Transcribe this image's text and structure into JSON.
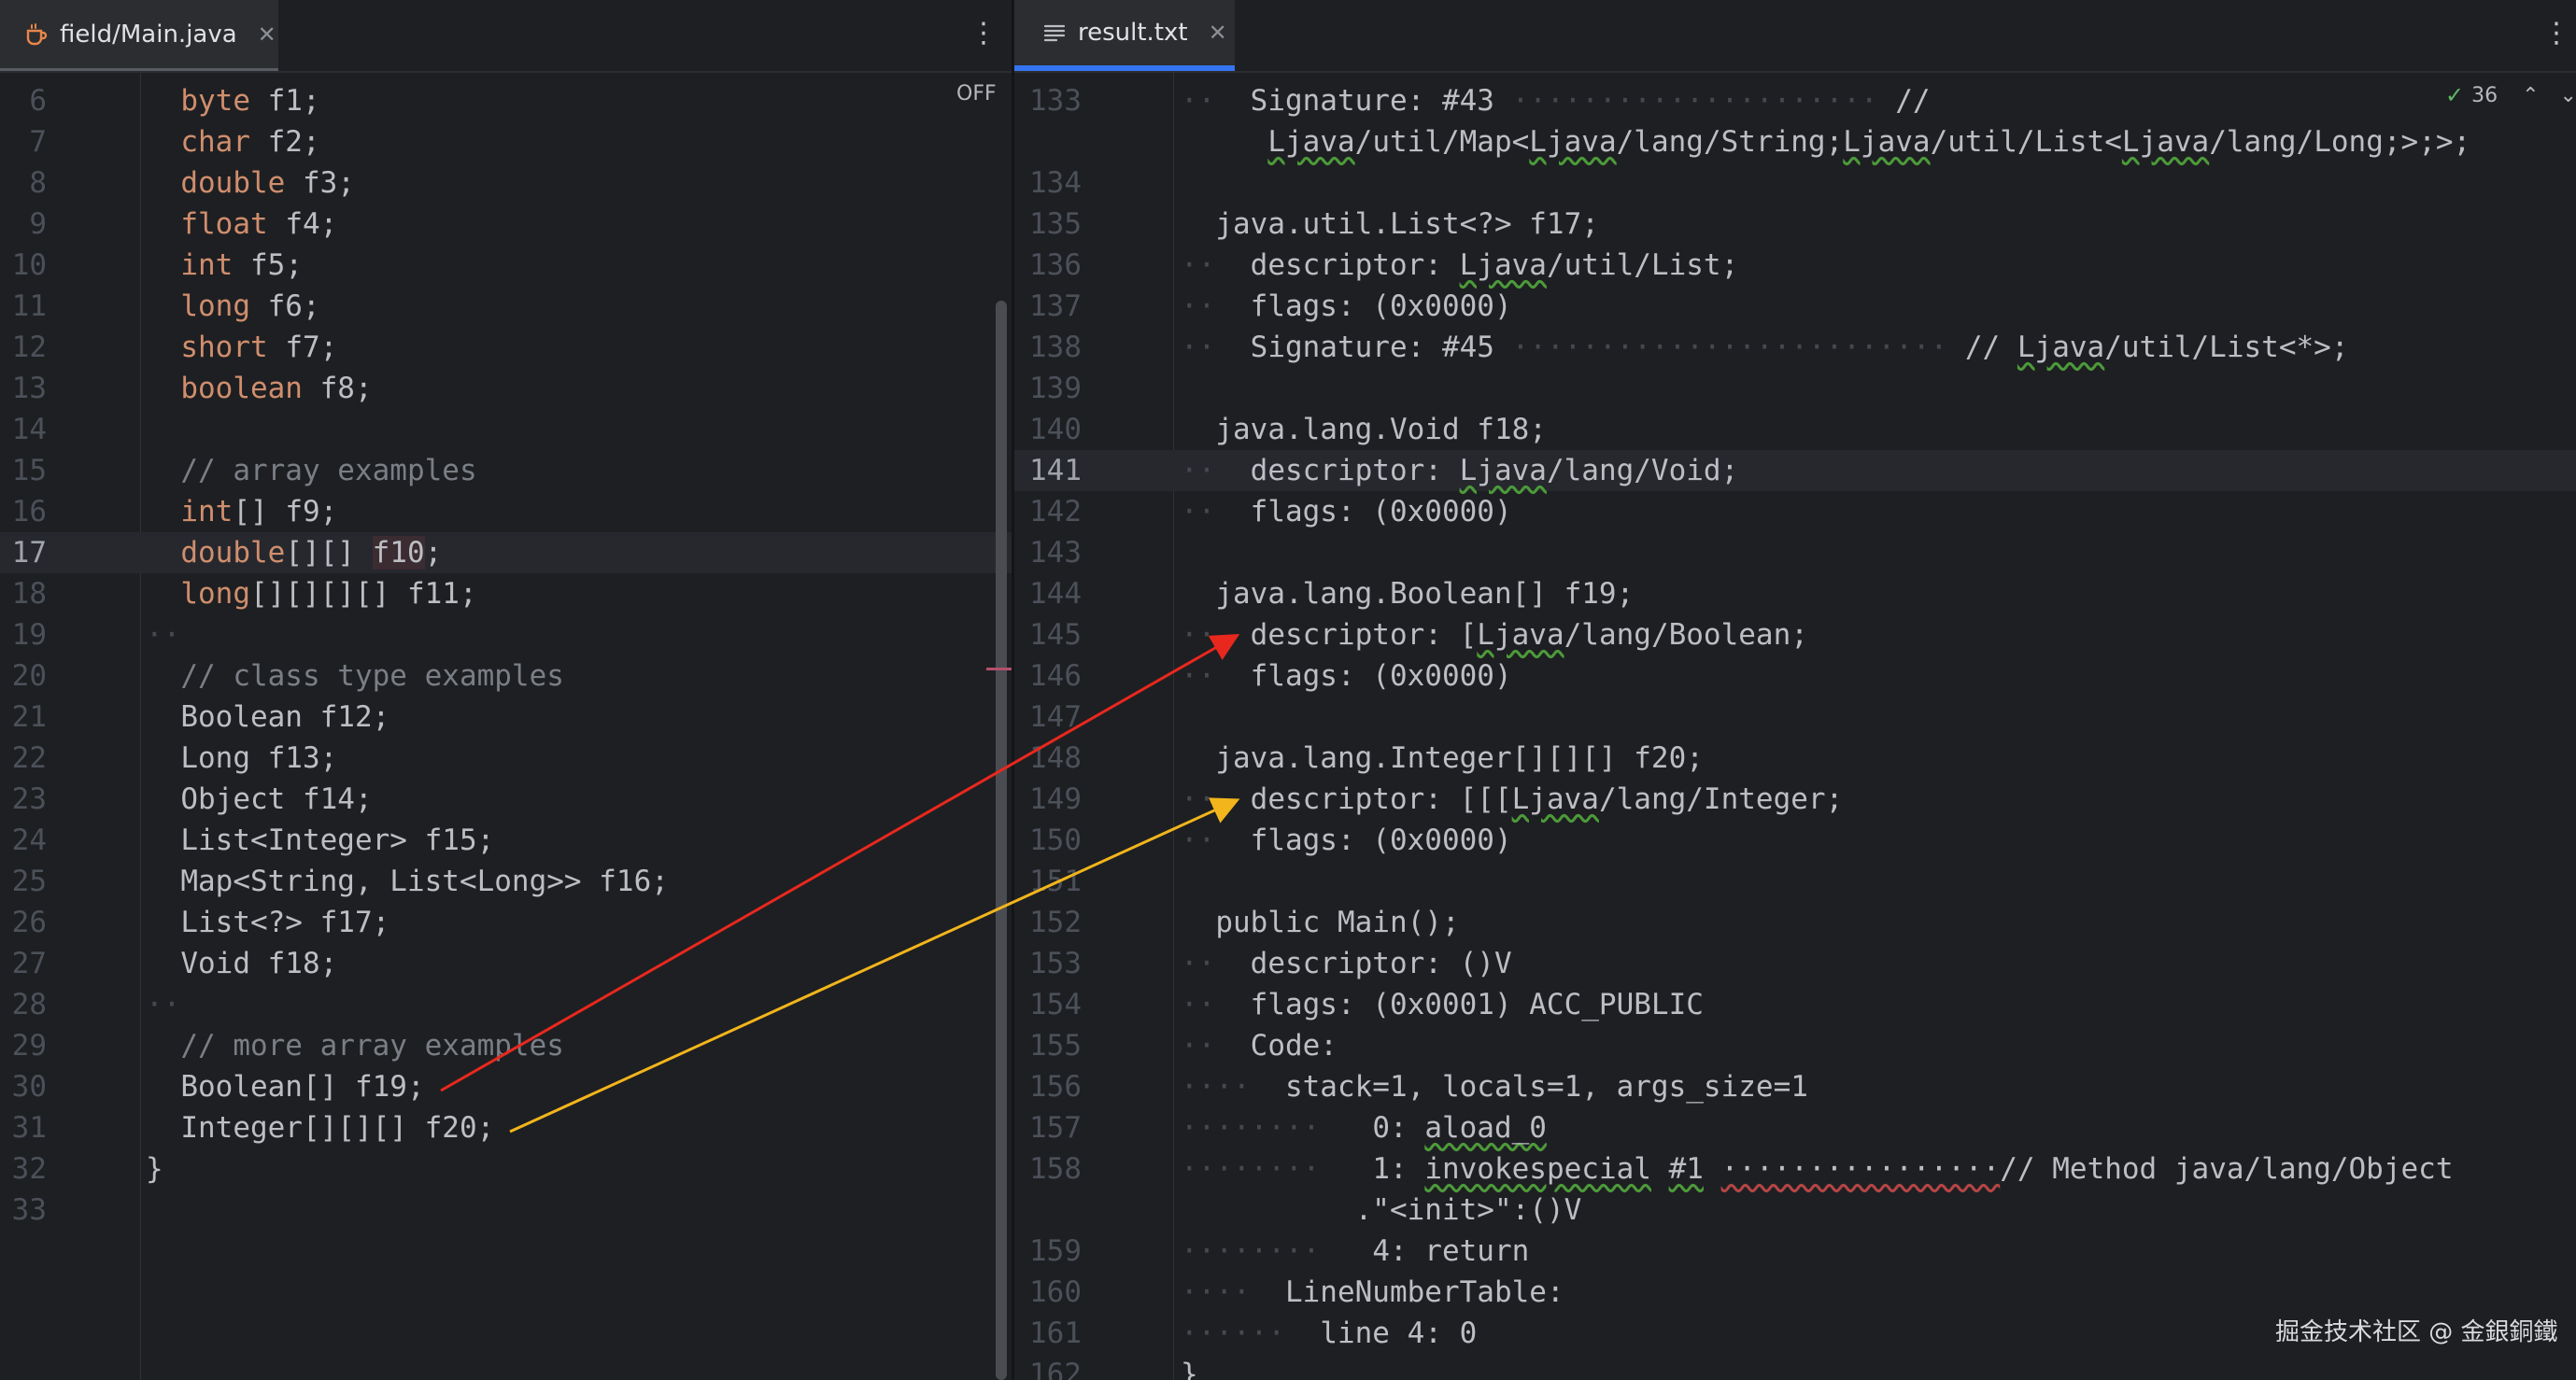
{
  "left_editor": {
    "tab_label": "field/Main.java",
    "off_label": "OFF",
    "lines": [
      {
        "n": "6",
        "tokens": [
          {
            "t": "  ",
            "c": "ws"
          },
          {
            "t": "byte",
            "c": "kw"
          },
          {
            "t": " f1;"
          }
        ]
      },
      {
        "n": "7",
        "tokens": [
          {
            "t": "  ",
            "c": "ws"
          },
          {
            "t": "char",
            "c": "kw"
          },
          {
            "t": " f2;"
          }
        ]
      },
      {
        "n": "8",
        "tokens": [
          {
            "t": "  ",
            "c": "ws"
          },
          {
            "t": "double",
            "c": "kw"
          },
          {
            "t": " f3;"
          }
        ]
      },
      {
        "n": "9",
        "tokens": [
          {
            "t": "  ",
            "c": "ws"
          },
          {
            "t": "float",
            "c": "kw"
          },
          {
            "t": " f4;"
          }
        ]
      },
      {
        "n": "10",
        "tokens": [
          {
            "t": "  ",
            "c": "ws"
          },
          {
            "t": "int",
            "c": "kw"
          },
          {
            "t": " f5;"
          }
        ]
      },
      {
        "n": "11",
        "tokens": [
          {
            "t": "  ",
            "c": "ws"
          },
          {
            "t": "long",
            "c": "kw"
          },
          {
            "t": " f6;"
          }
        ]
      },
      {
        "n": "12",
        "tokens": [
          {
            "t": "  ",
            "c": "ws"
          },
          {
            "t": "short",
            "c": "kw"
          },
          {
            "t": " f7;"
          }
        ]
      },
      {
        "n": "13",
        "tokens": [
          {
            "t": "  ",
            "c": "ws"
          },
          {
            "t": "boolean",
            "c": "kw"
          },
          {
            "t": " f8;"
          }
        ]
      },
      {
        "n": "14",
        "tokens": []
      },
      {
        "n": "15",
        "tokens": [
          {
            "t": "  ",
            "c": "ws"
          },
          {
            "t": "// array examples",
            "c": "cm"
          }
        ]
      },
      {
        "n": "16",
        "tokens": [
          {
            "t": "  ",
            "c": "ws"
          },
          {
            "t": "int",
            "c": "kw"
          },
          {
            "t": "[] f9;"
          }
        ]
      },
      {
        "n": "17",
        "current": true,
        "tokens": [
          {
            "t": "  ",
            "c": "ws"
          },
          {
            "t": "double",
            "c": "kw"
          },
          {
            "t": "[][] "
          },
          {
            "t": "f10",
            "c": "hl"
          },
          {
            "t": ";"
          }
        ]
      },
      {
        "n": "18",
        "tokens": [
          {
            "t": "  ",
            "c": "ws"
          },
          {
            "t": "long",
            "c": "kw"
          },
          {
            "t": "[][][][] f11;"
          }
        ]
      },
      {
        "n": "19",
        "tokens": [
          {
            "t": "··",
            "c": "ws"
          }
        ]
      },
      {
        "n": "20",
        "tokens": [
          {
            "t": "  ",
            "c": "ws"
          },
          {
            "t": "// class type examples",
            "c": "cm"
          }
        ]
      },
      {
        "n": "21",
        "tokens": [
          {
            "t": "  ",
            "c": "ws"
          },
          {
            "t": "Boolean f12;"
          }
        ]
      },
      {
        "n": "22",
        "tokens": [
          {
            "t": "  ",
            "c": "ws"
          },
          {
            "t": "Long f13;"
          }
        ]
      },
      {
        "n": "23",
        "tokens": [
          {
            "t": "  ",
            "c": "ws"
          },
          {
            "t": "Object f14;"
          }
        ]
      },
      {
        "n": "24",
        "tokens": [
          {
            "t": "  ",
            "c": "ws"
          },
          {
            "t": "List<Integer> f15;"
          }
        ]
      },
      {
        "n": "25",
        "tokens": [
          {
            "t": "  ",
            "c": "ws"
          },
          {
            "t": "Map<String, List<Long>> f16;"
          }
        ]
      },
      {
        "n": "26",
        "tokens": [
          {
            "t": "  ",
            "c": "ws"
          },
          {
            "t": "List<?> f17;"
          }
        ]
      },
      {
        "n": "27",
        "tokens": [
          {
            "t": "  ",
            "c": "ws"
          },
          {
            "t": "Void f18;"
          }
        ]
      },
      {
        "n": "28",
        "tokens": [
          {
            "t": "··",
            "c": "ws"
          }
        ]
      },
      {
        "n": "29",
        "tokens": [
          {
            "t": "  ",
            "c": "ws"
          },
          {
            "t": "// more array examples",
            "c": "cm"
          }
        ]
      },
      {
        "n": "30",
        "tokens": [
          {
            "t": "  ",
            "c": "ws"
          },
          {
            "t": "Boolean[] f19;"
          }
        ]
      },
      {
        "n": "31",
        "tokens": [
          {
            "t": "  ",
            "c": "ws"
          },
          {
            "t": "Integer[][][] f20;"
          }
        ]
      },
      {
        "n": "32",
        "tokens": [
          {
            "t": "}"
          }
        ]
      },
      {
        "n": "33",
        "tokens": []
      }
    ]
  },
  "right_editor": {
    "tab_label": "result.txt",
    "inspection_count": "36",
    "lines": [
      {
        "n": "133",
        "tokens": [
          {
            "t": "··  ",
            "c": "ws"
          },
          {
            "t": "Signature: #43 "
          },
          {
            "t": "·····················",
            "c": "ws"
          },
          {
            "t": " //"
          }
        ]
      },
      {
        "n": "",
        "tokens": [
          {
            "t": "     "
          },
          {
            "t": "Ljava",
            "c": "sq"
          },
          {
            "t": "/util/Map<"
          },
          {
            "t": "Ljava",
            "c": "sq"
          },
          {
            "t": "/lang/String;"
          },
          {
            "t": "Ljava",
            "c": "sq"
          },
          {
            "t": "/util/List<"
          },
          {
            "t": "Ljava",
            "c": "sq"
          },
          {
            "t": "/lang/Long;>;>;"
          }
        ]
      },
      {
        "n": "134",
        "tokens": []
      },
      {
        "n": "135",
        "tokens": [
          {
            "t": "  ",
            "c": "ws"
          },
          {
            "t": "java.util.List<?> f17;"
          }
        ]
      },
      {
        "n": "136",
        "tokens": [
          {
            "t": "··  ",
            "c": "ws"
          },
          {
            "t": "descriptor: "
          },
          {
            "t": "Ljava",
            "c": "sq"
          },
          {
            "t": "/util/List;"
          }
        ]
      },
      {
        "n": "137",
        "tokens": [
          {
            "t": "··  ",
            "c": "ws"
          },
          {
            "t": "flags: (0x0000)"
          }
        ]
      },
      {
        "n": "138",
        "tokens": [
          {
            "t": "··  ",
            "c": "ws"
          },
          {
            "t": "Signature: #45 "
          },
          {
            "t": "·························",
            "c": "ws"
          },
          {
            "t": " // "
          },
          {
            "t": "Ljava",
            "c": "sq"
          },
          {
            "t": "/util/List<*>;"
          }
        ]
      },
      {
        "n": "139",
        "tokens": []
      },
      {
        "n": "140",
        "tokens": [
          {
            "t": "  ",
            "c": "ws"
          },
          {
            "t": "java.lang.Void f18;"
          }
        ]
      },
      {
        "n": "141",
        "current": true,
        "tokens": [
          {
            "t": "··  ",
            "c": "ws"
          },
          {
            "t": "descriptor: "
          },
          {
            "t": "Ljava",
            "c": "sq"
          },
          {
            "t": "/lang/Void;"
          }
        ]
      },
      {
        "n": "142",
        "tokens": [
          {
            "t": "··  ",
            "c": "ws"
          },
          {
            "t": "flags: (0x0000)"
          }
        ]
      },
      {
        "n": "143",
        "tokens": []
      },
      {
        "n": "144",
        "tokens": [
          {
            "t": "  ",
            "c": "ws"
          },
          {
            "t": "java.lang.Boolean[] f19;"
          }
        ]
      },
      {
        "n": "145",
        "tokens": [
          {
            "t": "··  ",
            "c": "ws"
          },
          {
            "t": "descriptor: ["
          },
          {
            "t": "Ljava",
            "c": "sq"
          },
          {
            "t": "/lang/Boolean;"
          }
        ]
      },
      {
        "n": "146",
        "tokens": [
          {
            "t": "··  ",
            "c": "ws"
          },
          {
            "t": "flags: (0x0000)"
          }
        ]
      },
      {
        "n": "147",
        "tokens": []
      },
      {
        "n": "148",
        "tokens": [
          {
            "t": "  ",
            "c": "ws"
          },
          {
            "t": "java.lang.Integer[][][] f20;"
          }
        ]
      },
      {
        "n": "149",
        "tokens": [
          {
            "t": "··  ",
            "c": "ws"
          },
          {
            "t": "descriptor: [[["
          },
          {
            "t": "Ljava",
            "c": "sq"
          },
          {
            "t": "/lang/Integer;"
          }
        ]
      },
      {
        "n": "150",
        "tokens": [
          {
            "t": "··  ",
            "c": "ws"
          },
          {
            "t": "flags: (0x0000)"
          }
        ]
      },
      {
        "n": "151",
        "tokens": []
      },
      {
        "n": "152",
        "tokens": [
          {
            "t": "  ",
            "c": "ws"
          },
          {
            "t": "public Main();"
          }
        ]
      },
      {
        "n": "153",
        "tokens": [
          {
            "t": "··  ",
            "c": "ws"
          },
          {
            "t": "descriptor: ()V"
          }
        ]
      },
      {
        "n": "154",
        "tokens": [
          {
            "t": "··  ",
            "c": "ws"
          },
          {
            "t": "flags: (0x0001) ACC_PUBLIC"
          }
        ]
      },
      {
        "n": "155",
        "tokens": [
          {
            "t": "··  ",
            "c": "ws"
          },
          {
            "t": "Code:"
          }
        ]
      },
      {
        "n": "156",
        "tokens": [
          {
            "t": "····  ",
            "c": "ws"
          },
          {
            "t": "stack=1, locals=1, args_size=1"
          }
        ]
      },
      {
        "n": "157",
        "tokens": [
          {
            "t": "········   ",
            "c": "ws"
          },
          {
            "t": "0: "
          },
          {
            "t": "aload_0",
            "c": "sq"
          }
        ]
      },
      {
        "n": "158",
        "tokens": [
          {
            "t": "········   ",
            "c": "ws"
          },
          {
            "t": "1: "
          },
          {
            "t": "invokespecial",
            "c": "sq"
          },
          {
            "t": " "
          },
          {
            "t": "#1",
            "c": "sq"
          },
          {
            "t": " "
          },
          {
            "t": "················",
            "c": "sqr"
          },
          {
            "t": "// Method java/lang/Object"
          }
        ]
      },
      {
        "n": "",
        "tokens": [
          {
            "t": "        "
          },
          {
            "t": "  .\"<init>\":()V"
          }
        ]
      },
      {
        "n": "159",
        "tokens": [
          {
            "t": "········   ",
            "c": "ws"
          },
          {
            "t": "4: return"
          }
        ]
      },
      {
        "n": "160",
        "tokens": [
          {
            "t": "····  ",
            "c": "ws"
          },
          {
            "t": "LineNumberTable:"
          }
        ]
      },
      {
        "n": "161",
        "tokens": [
          {
            "t": "······  ",
            "c": "ws"
          },
          {
            "t": "line 4: 0"
          }
        ]
      },
      {
        "n": "162",
        "tokens": [
          {
            "t": "}"
          }
        ]
      }
    ]
  },
  "icons": {
    "left_tab": "java-file-icon",
    "right_tab": "text-file-icon",
    "inspection": "check-icon"
  },
  "arrows": [
    {
      "from_line": "30",
      "to_line": "145",
      "color": "#e8281e"
    },
    {
      "from_line": "31",
      "to_line": "149",
      "color": "#f2b51c"
    }
  ],
  "watermark": "掘金技术社区 @ 金銀銅鐵",
  "colors": {
    "background": "#1e1f22",
    "keyword": "#cf8e6d",
    "comment": "#7a7e85",
    "accent": "#3574f0"
  }
}
